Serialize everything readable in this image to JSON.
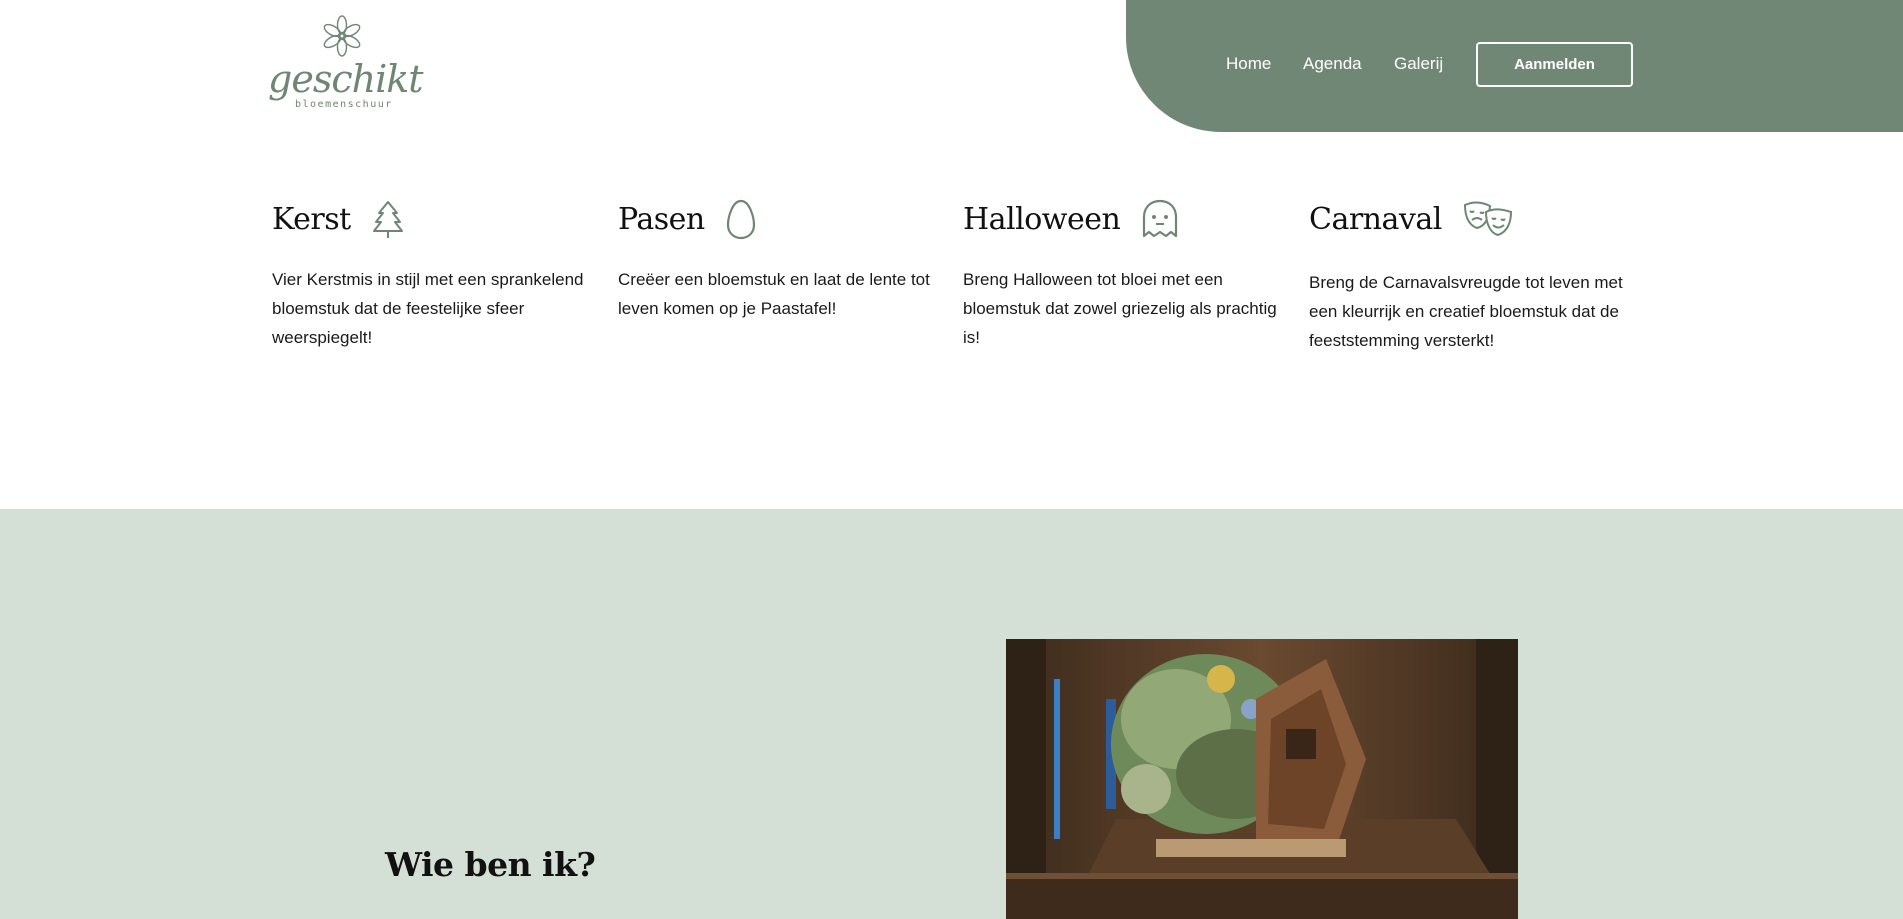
{
  "logo": {
    "wordmark": "geschikt",
    "subtitle": "bloemenschuur"
  },
  "nav": {
    "home": "Home",
    "agenda": "Agenda",
    "galerij": "Galerij",
    "signup": "Aanmelden"
  },
  "colors": {
    "accent": "#718775",
    "section_bg": "#d4e0d6"
  },
  "themes": [
    {
      "title": "Kerst",
      "icon": "christmas-tree-icon",
      "description": "Vier Kerstmis in stijl met een sprankelend bloemstuk dat de feestelijke sfeer weerspiegelt!"
    },
    {
      "title": "Pasen",
      "icon": "egg-icon",
      "description": "Creëer een bloemstuk en laat de lente tot leven komen op je Paastafel!"
    },
    {
      "title": "Halloween",
      "icon": "ghost-icon",
      "description": "Breng Halloween tot bloei met een bloemstuk dat zowel griezelig als prachtig is!"
    },
    {
      "title": "Carnaval",
      "icon": "theater-masks-icon",
      "description": "Breng de Carnavalsvreugde tot leven met een kleurrijk en creatief bloemstuk dat de feeststemming versterkt!"
    }
  ],
  "about": {
    "title": "Wie ben ik?",
    "image": "flower-arrangement-photo"
  }
}
